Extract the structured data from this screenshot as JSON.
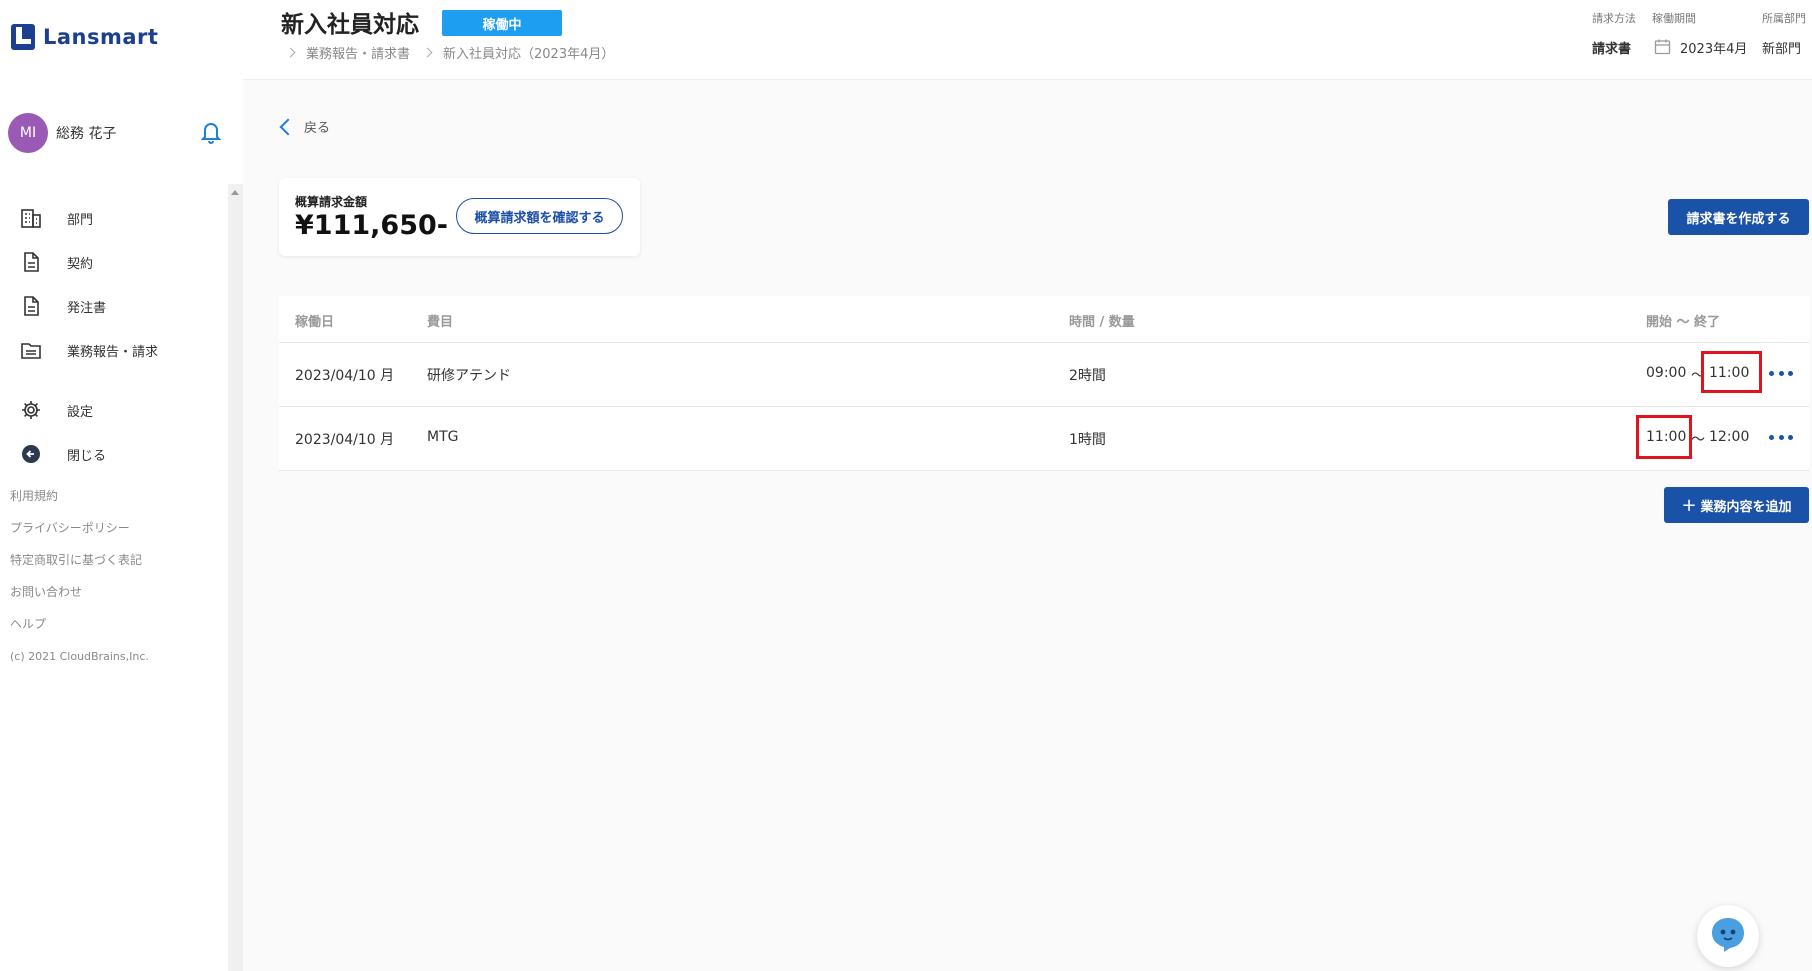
{
  "app": {
    "name": "Lansmart",
    "brand_color": "#1d3f8f"
  },
  "user": {
    "initials": "MI",
    "name": "総務 花子"
  },
  "sidebar": {
    "items": [
      {
        "label": "部門",
        "icon": "building-icon"
      },
      {
        "label": "契約",
        "icon": "document-icon"
      },
      {
        "label": "発注書",
        "icon": "document-icon"
      },
      {
        "label": "業務報告・請求",
        "icon": "folder-icon"
      },
      {
        "label": "設定",
        "icon": "gear-icon"
      },
      {
        "label": "閉じる",
        "icon": "arrow-left-circle-icon"
      }
    ],
    "footer_links": [
      "利用規約",
      "プライバシーポリシー",
      "特定商取引に基づく表記",
      "お問い合わせ",
      "ヘルプ"
    ],
    "copyright": "(c) 2021 CloudBrains,Inc."
  },
  "header": {
    "title": "新入社員対応",
    "status": "稼働中",
    "breadcrumb": [
      "業務報告・請求書",
      "新入社員対応（2023年4月）"
    ],
    "meta": [
      {
        "label": "請求方法",
        "value": "請求書"
      },
      {
        "label": "稼働期間",
        "value": "2023年4月"
      },
      {
        "label": "所属部門",
        "value": "新部門"
      }
    ]
  },
  "main": {
    "back_label": "戻る",
    "estimate": {
      "label": "概算請求金額",
      "amount": "¥111,650-",
      "button": "概算請求額を確認する"
    },
    "create_invoice_button": "請求書を作成する",
    "table": {
      "headers": {
        "date": "稼働日",
        "item": "費目",
        "qty": "時間 / 数量",
        "period": "開始 ～ 終了"
      },
      "rows": [
        {
          "date": "2023/04/10 月",
          "item": "研修アテンド",
          "qty": "2時間",
          "start": "09:00",
          "sep": "～",
          "end": "11:00"
        },
        {
          "date": "2023/04/10 月",
          "item": "MTG",
          "qty": "1時間",
          "start": "11:00",
          "sep": "～",
          "end": "12:00"
        }
      ]
    },
    "add_button": "業務内容を追加"
  },
  "colors": {
    "accent": "#1a52a8",
    "status_badge": "#1e9ef0",
    "highlight": "#e0141e",
    "avatar": "#9b59b6"
  }
}
